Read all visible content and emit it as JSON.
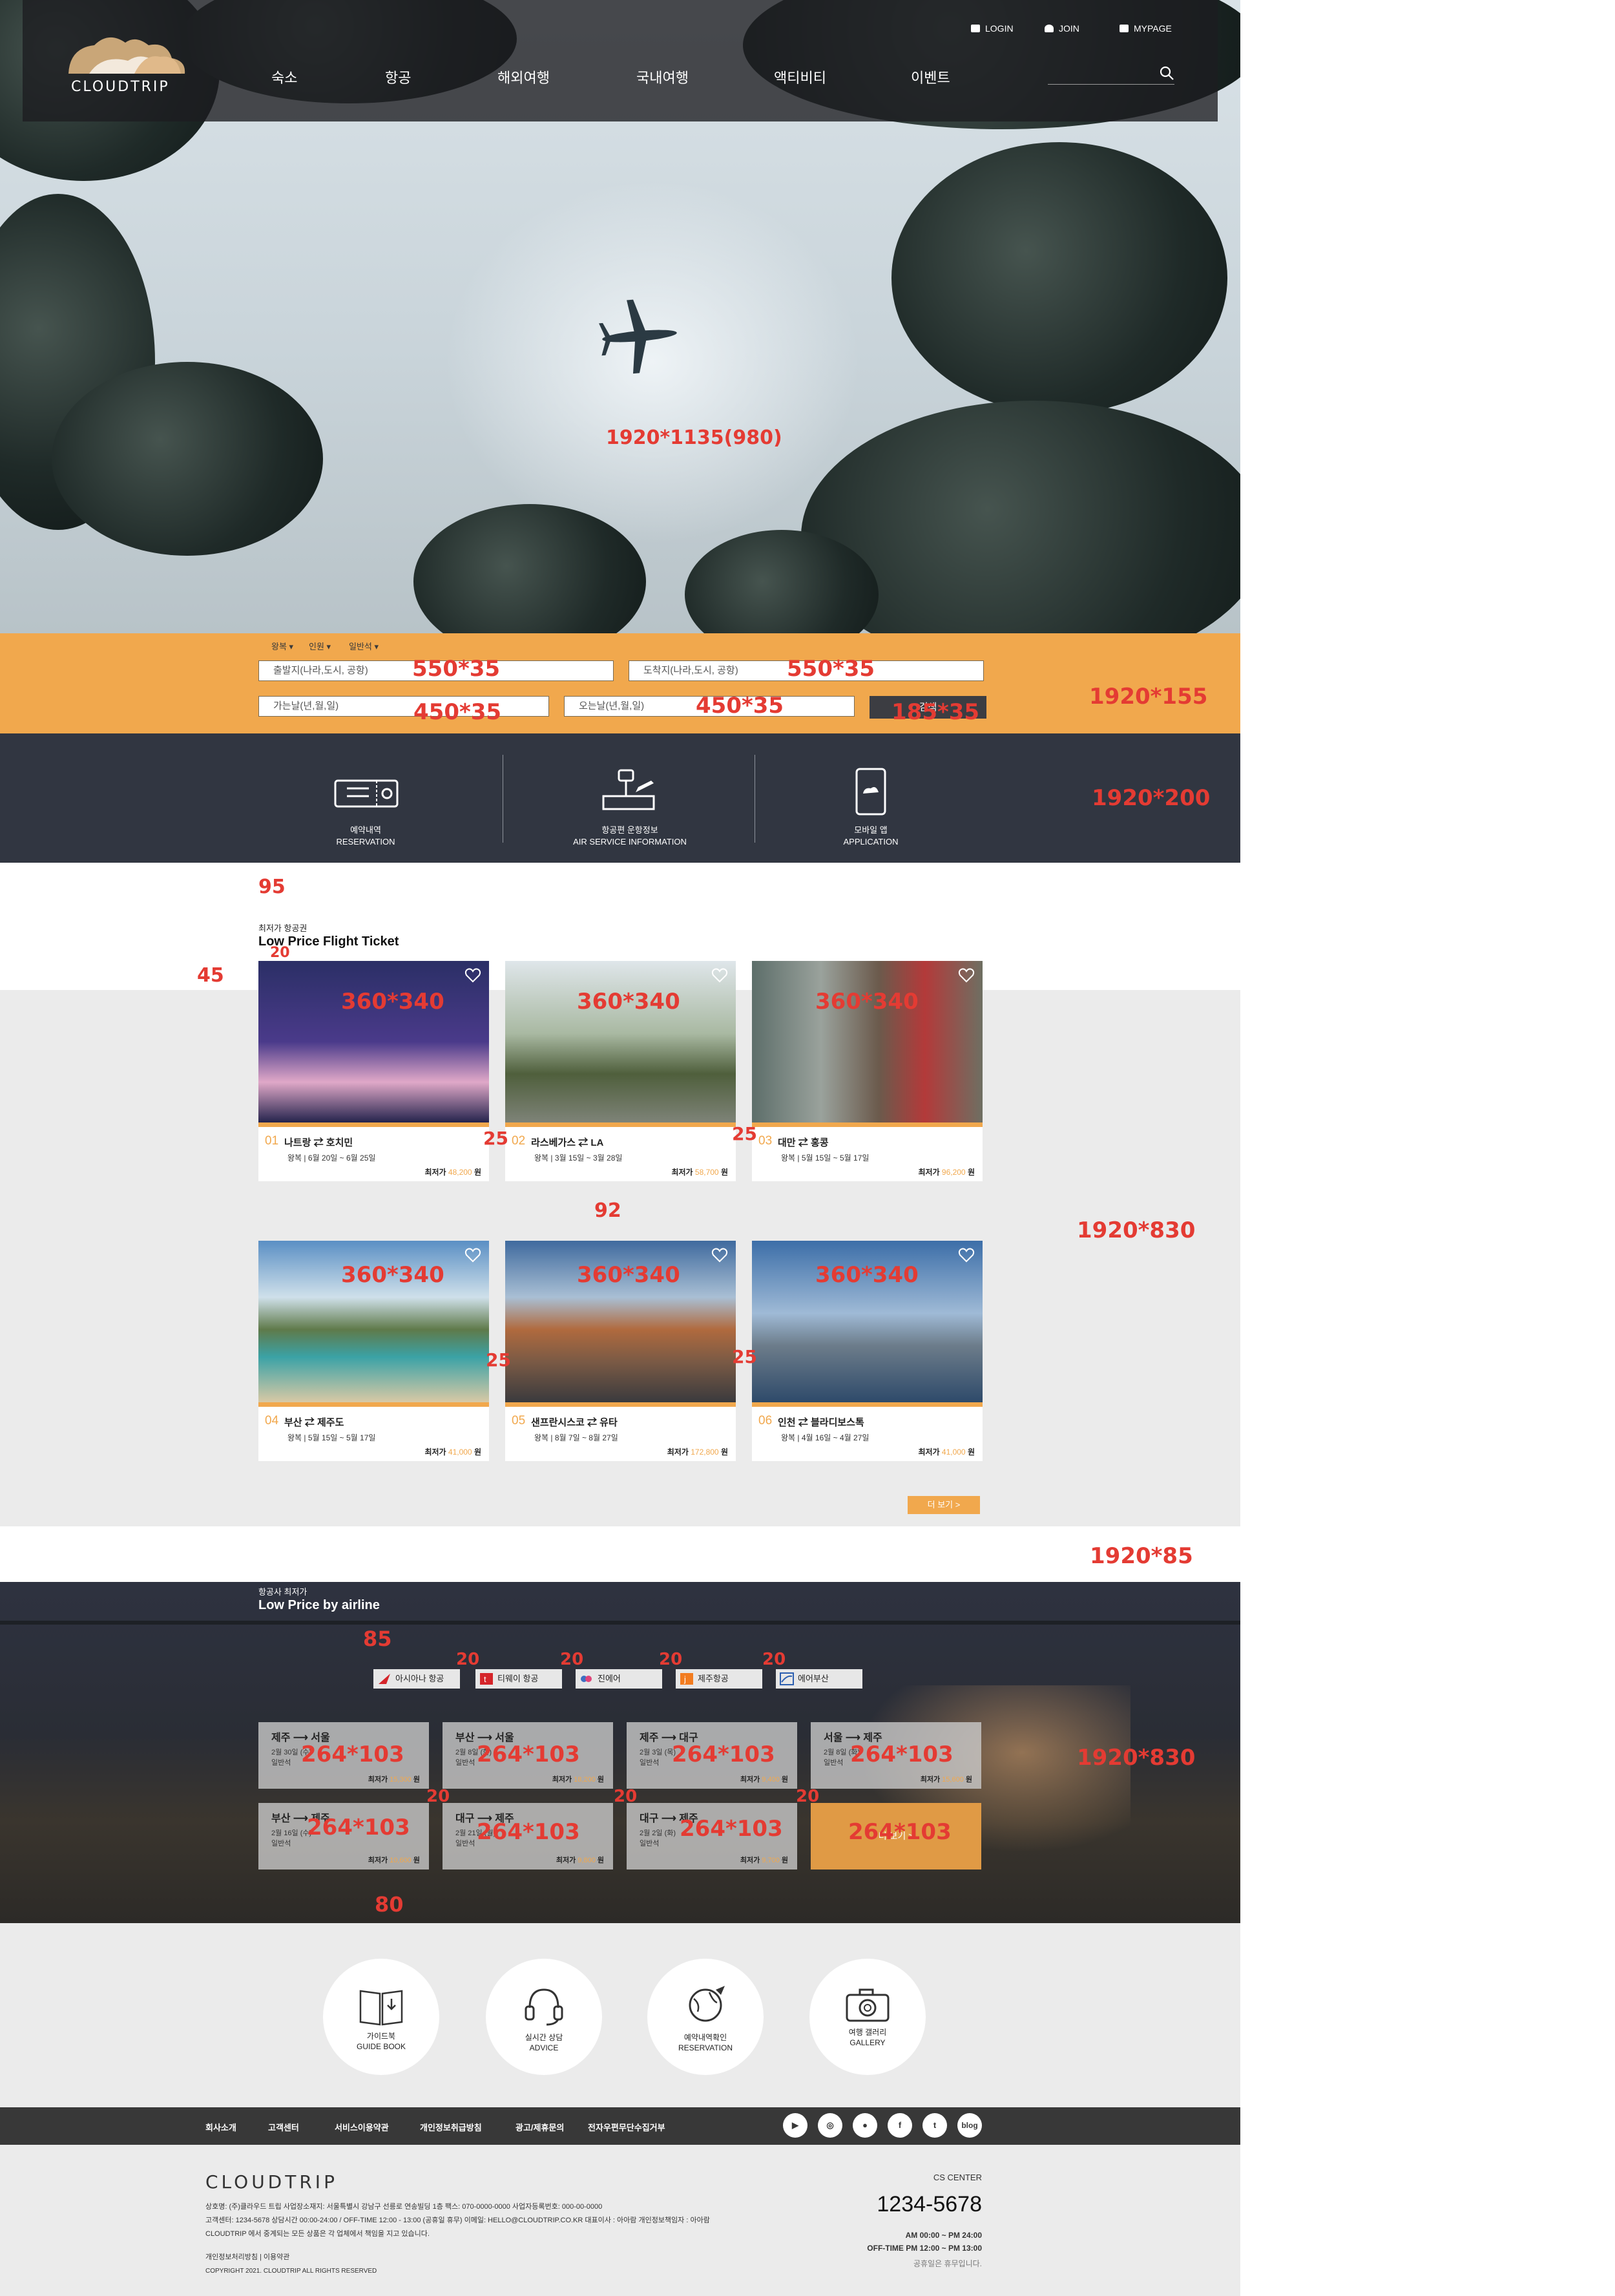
{
  "header": {
    "logo_text": "CLOUDTRIP",
    "util": {
      "login": "LOGIN",
      "join": "JOIN",
      "mypage": "MYPAGE"
    },
    "nav": [
      "숙소",
      "항공",
      "해외여행",
      "국내여행",
      "액티비티",
      "이벤트"
    ]
  },
  "hero": {
    "size_note": "1920*1135(980)"
  },
  "booking": {
    "trip_type": "왕복 ▾",
    "people": "인원 ▾",
    "seat": "일반석 ▾",
    "from_placeholder": "출발지(나라,도시, 공항)",
    "to_placeholder": "도착지(나라,도시, 공항)",
    "depart_placeholder": "가는날(년,월,일)",
    "return_placeholder": "오는날(년,월,일)",
    "search_label": "검색",
    "notes": {
      "from": "550*35",
      "to": "550*35",
      "depart": "450*35",
      "return": "450*35",
      "button": "185*35",
      "section": "1920*155"
    }
  },
  "services": {
    "items": [
      {
        "ko": "예약내역",
        "en": "RESERVATION",
        "icon": "ticket-icon"
      },
      {
        "ko": "항공편 운항정보",
        "en": "AIR SERVICE INFORMATION",
        "icon": "airport-icon"
      },
      {
        "ko": "모바일 앱",
        "en": "APPLICATION",
        "icon": "mobile-icon"
      }
    ],
    "note": "1920*200"
  },
  "low_price": {
    "subtitle": "최저가 항공권",
    "title": "Low Price Flight Ticket",
    "price_prefix": "최저가",
    "currency": "원",
    "more_label": "더 보기 >",
    "cards": [
      {
        "num": "01",
        "from": "나트랑",
        "to": "호치민",
        "dates": "왕복 | 6월 20일 ~ 6월 25일",
        "price": "48,200"
      },
      {
        "num": "02",
        "from": "라스베가스",
        "to": "LA",
        "dates": "왕복 | 3월 15일 ~ 3월 28일",
        "price": "58,700"
      },
      {
        "num": "03",
        "from": "대만",
        "to": "홍콩",
        "dates": "왕복 | 5월 15일 ~ 5월 17일",
        "price": "96,200"
      },
      {
        "num": "04",
        "from": "부산",
        "to": "제주도",
        "dates": "왕복 | 5월 15일 ~ 5월 17일",
        "price": "41,000"
      },
      {
        "num": "05",
        "from": "샌프란시스코",
        "to": "유타",
        "dates": "왕복 | 8월 7일 ~ 8월 27일",
        "price": "172,800"
      },
      {
        "num": "06",
        "from": "인천",
        "to": "블라디보스톡",
        "dates": "왕복 | 4월 16일 ~ 4월 27일",
        "price": "41,000"
      }
    ],
    "notes": {
      "top": "95",
      "left": "45",
      "title_gap": "20",
      "card": "360*340",
      "gap": "25",
      "row_gap": "92",
      "section": "1920*830",
      "between": "1920*85"
    }
  },
  "airline_section": {
    "subtitle": "항공사 최저가",
    "title": "Low Price by airline",
    "airlines": [
      "아시아나 항공",
      "티웨이 항공",
      "진에어",
      "제주항공",
      "에어부산"
    ],
    "price_prefix": "최저가",
    "currency": "원",
    "fares": [
      {
        "from": "제주",
        "to": "서울",
        "date": "2월 30일 (수)",
        "class": "일반석",
        "price": "15,300"
      },
      {
        "from": "부산",
        "to": "서울",
        "date": "2월 8일 (화)",
        "class": "일반석",
        "price": "18,200"
      },
      {
        "from": "제주",
        "to": "대구",
        "date": "2월 3일 (목)",
        "class": "일반석",
        "price": "9,400"
      },
      {
        "from": "서울",
        "to": "제주",
        "date": "2월 8일 (화)",
        "class": "일반석",
        "price": "15,600"
      },
      {
        "from": "부산",
        "to": "제주",
        "date": "2월 16일 (수)",
        "class": "일반석",
        "price": "10,600"
      },
      {
        "from": "대구",
        "to": "제주",
        "date": "2월 21일 (월)",
        "class": "일반석",
        "price": "9,800"
      },
      {
        "from": "대구",
        "to": "제주",
        "date": "2월 2일 (화)",
        "class": "일반석",
        "price": "9,700"
      }
    ],
    "more_label": "더 보기 >",
    "notes": {
      "gap85": "85",
      "gap20": "20",
      "fare": "264*103",
      "bottom": "80",
      "section": "1920*830"
    }
  },
  "quick_links": [
    {
      "ko": "가이드북",
      "en": "GUIDE BOOK",
      "icon": "book-icon"
    },
    {
      "ko": "실시간 상담",
      "en": "ADVICE",
      "icon": "headset-icon"
    },
    {
      "ko": "예약내역확인",
      "en": "RESERVATION",
      "icon": "globe-plane-icon"
    },
    {
      "ko": "여행 갤러리",
      "en": "GALLERY",
      "icon": "camera-icon"
    }
  ],
  "footer": {
    "links": [
      "회사소개",
      "고객센터",
      "서비스이용약관",
      "개인정보취급방침",
      "광고/제휴문의",
      "전자우편무단수집거부"
    ],
    "sns": [
      "youtube-icon",
      "instagram-icon",
      "chat-icon",
      "facebook-icon",
      "twitter-icon",
      "blog-icon"
    ],
    "sns_blog_label": "blog",
    "brand": "CLOUDTRIP",
    "info_lines": [
      "상호명: (주)클라우드 트립   사업장소재지: 서울특별시 강남구 선릉로 연송빌딩 1층   팩스: 070-0000-0000   사업자등록번호: 000-00-0000",
      "고객센터: 1234-5678   상담시간 00:00-24:00  /  OFF-TIME 12:00 - 13:00 (공휴일 휴무)   이메일: HELLO@CLOUDTRIP.CO.KR   대표이사 : 아아람   개인정보책임자 : 아아람",
      "CLOUDTRIP 에서 중계되는 모든 상품은 각 업체에서 책임을 지고 있습니다."
    ],
    "policy": "개인정보처리방침   |   이용약관",
    "copyright": "COPYRIGHT 2021. CLOUDTRIP ALL RIGHTS RESERVED",
    "cs_label": "CS CENTER",
    "cs_phone": "1234-5678",
    "cs_hours1": "AM 00:00 ~ PM 24:00",
    "cs_hours2": "OFF-TIME PM 12:00 ~ PM 13:00",
    "cs_holiday": "공휴일은 휴무입니다."
  },
  "colors": {
    "accent": "#f1a84d",
    "dark": "#313641",
    "light_bg": "#ebebeb",
    "annotation": "#e43b33"
  }
}
